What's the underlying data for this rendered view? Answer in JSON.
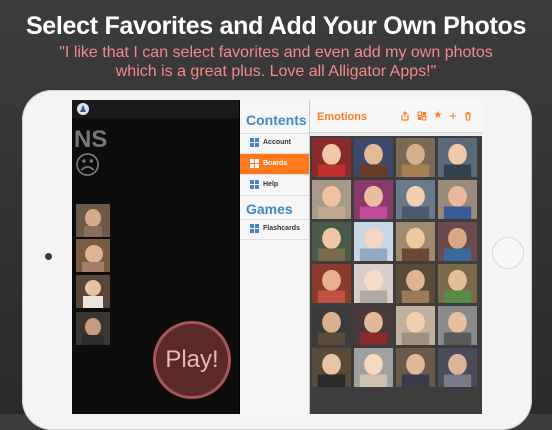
{
  "headline": "Select Favorites and Add Your Own Photos",
  "quote_line1": "\"I like that I can select favorites and even add my own photos",
  "quote_line2": "which is a great plus.  Love all Alligator Apps!\"",
  "left_panel": {
    "heading_fragment": "NS",
    "sad_symbol": "☹",
    "play_label": "Play!"
  },
  "menu": {
    "contents_heading": "Contents",
    "games_heading": "Games",
    "items": [
      {
        "label": "Account",
        "active": false
      },
      {
        "label": "Boards",
        "active": true
      },
      {
        "label": "Help",
        "active": false
      },
      {
        "label": "Flashcards",
        "active": false
      }
    ]
  },
  "board": {
    "title": "Emotions",
    "toolbar_icons": [
      "share-icon",
      "grid-icon",
      "star-icon",
      "plus-icon",
      "trash-icon"
    ],
    "rows": 6,
    "columns": 4
  },
  "colors": {
    "accent": "#ff7a1c",
    "heading_blue": "#3f87c6",
    "quote_pink": "#f08a8c"
  }
}
